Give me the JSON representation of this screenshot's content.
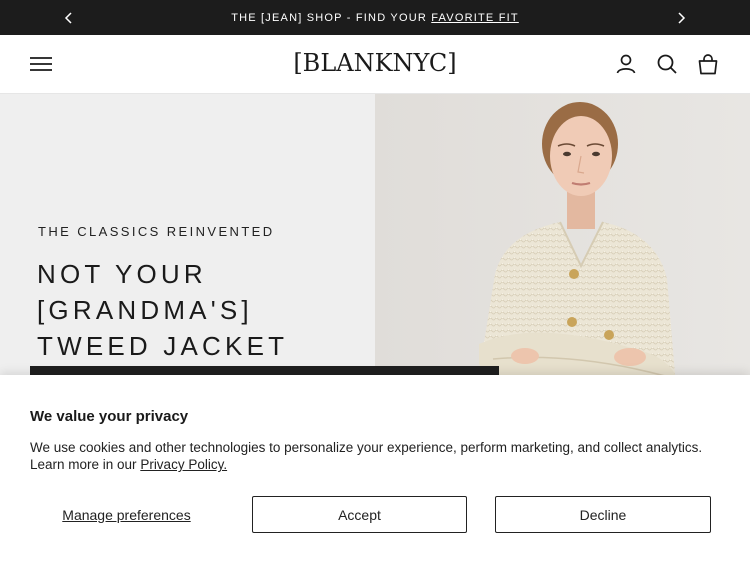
{
  "announcement": {
    "text_prefix": "THE [JEAN] SHOP - FIND YOUR ",
    "link_text": "FAVORITE FIT",
    "prev_icon": "chevron-left-icon",
    "next_icon": "chevron-right-icon"
  },
  "header": {
    "logo": "[BLANKNYC]",
    "icons": [
      "menu-icon",
      "account-icon",
      "search-icon",
      "bag-icon"
    ]
  },
  "hero": {
    "eyebrow": "THE CLASSICS REINVENTED",
    "headline_lines": [
      "NOT YOUR",
      "[GRANDMA'S]",
      "TWEED JACKET"
    ]
  },
  "cookie_banner": {
    "title": "We value your privacy",
    "body": "We use cookies and other technologies to personalize your experience, perform marketing, and collect analytics. Learn more in our ",
    "policy_link": "Privacy Policy.",
    "manage_label": "Manage preferences",
    "accept_label": "Accept",
    "decline_label": "Decline"
  },
  "colors": {
    "announcement_bg": "#1c1c1c",
    "hero_left_bg": "#efefef",
    "hero_right_bg": "#e4e2df"
  }
}
